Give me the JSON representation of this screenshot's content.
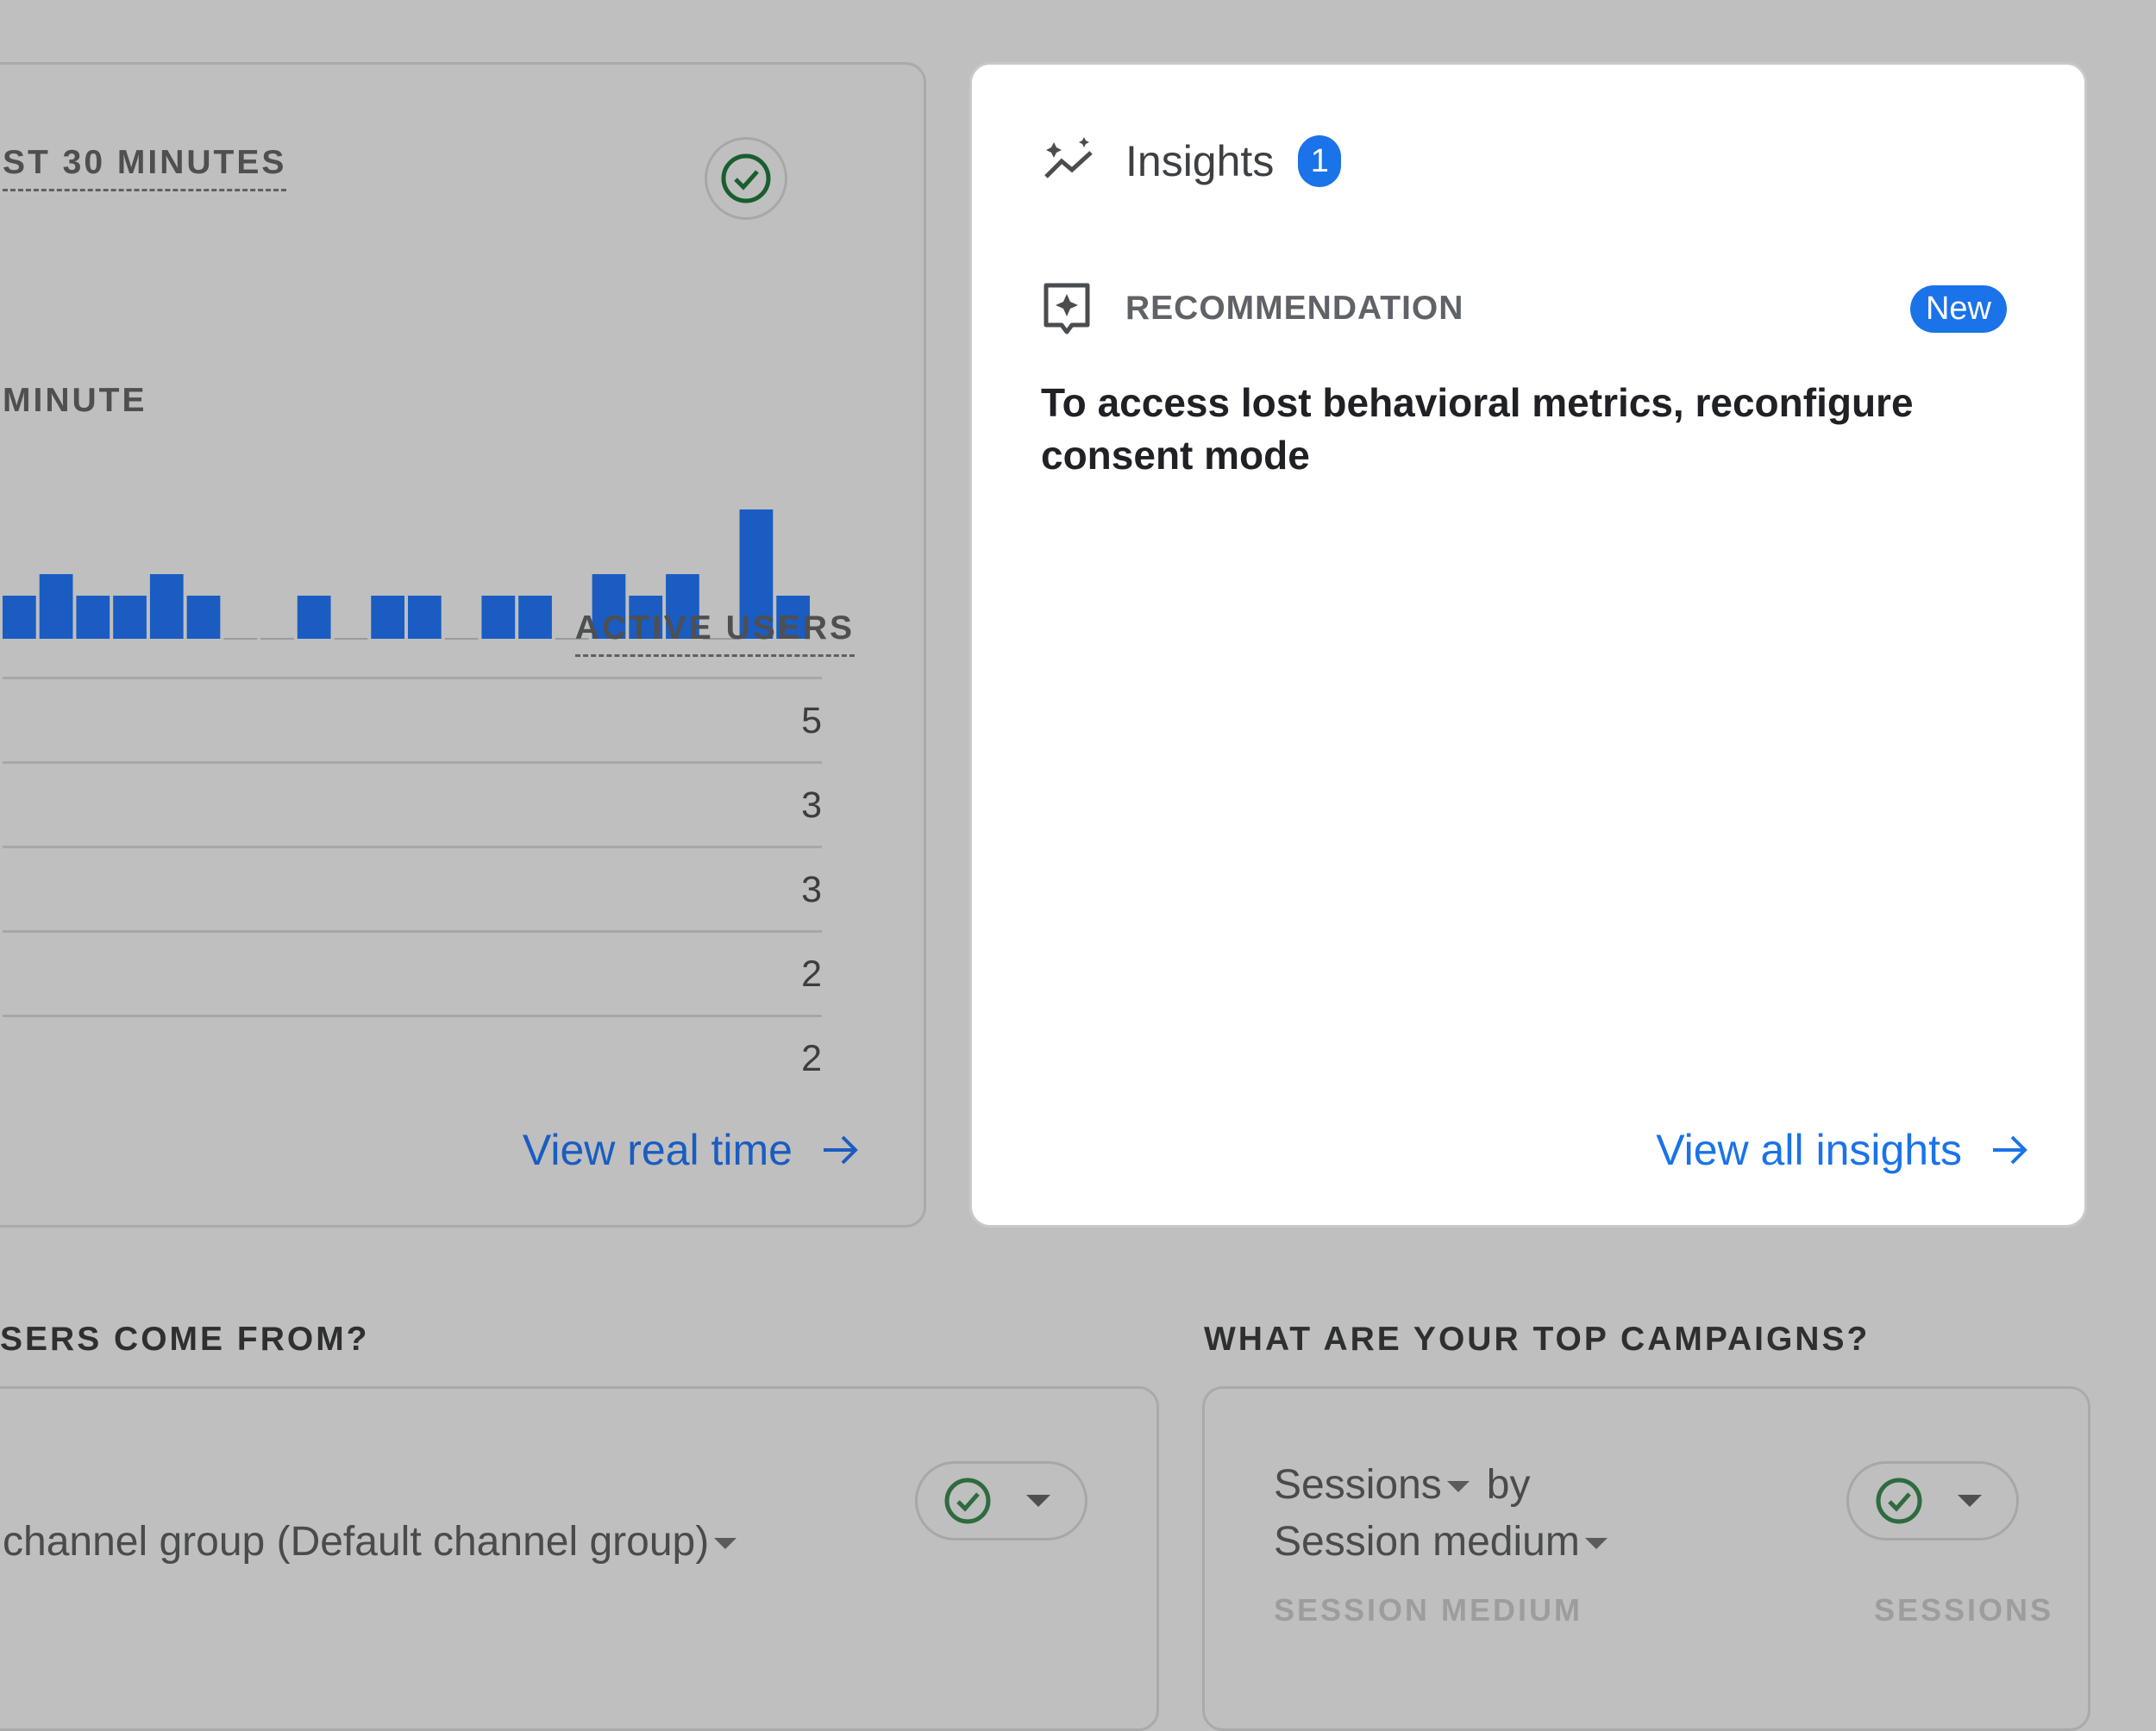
{
  "realtime": {
    "title": "ST 30 MINUTES",
    "subtitle": "MINUTE",
    "column_header": "ACTIVE USERS",
    "rows": [
      "5",
      "3",
      "3",
      "2",
      "2"
    ],
    "link": "View real time",
    "check_icon": "check-circle-icon",
    "bars": [
      2,
      3,
      2,
      2,
      3,
      2,
      0,
      0,
      2,
      0,
      2,
      2,
      0,
      2,
      2,
      0,
      3,
      2,
      3,
      0,
      6,
      2
    ],
    "bar_color": "#1a5cc2"
  },
  "insights": {
    "title": "Insights",
    "badge": "1",
    "recommendation_label": "RECOMMENDATION",
    "new_badge": "New",
    "recommendation_text": "To access lost behavioral metrics, reconfigure consent mode",
    "link": "View all insights",
    "accent": "#1a73e8"
  },
  "bottom": {
    "left_question": "SERS COME FROM?",
    "right_question": "WHAT ARE YOUR TOP CAMPAIGNS?",
    "left_dimension": "channel group (Default channel group)",
    "right_metric": "Sessions",
    "right_by": "by",
    "right_dimension": "Session medium",
    "right_col1": "SESSION MEDIUM",
    "right_col2": "SESSIONS"
  }
}
